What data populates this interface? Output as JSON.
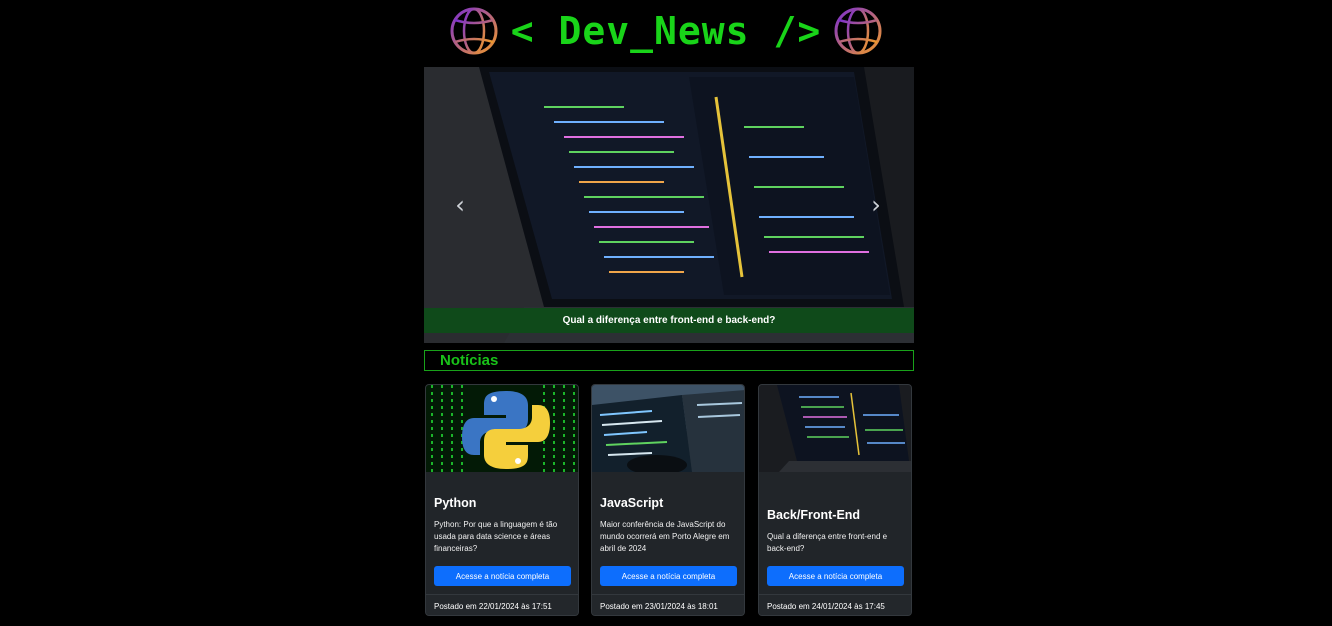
{
  "header": {
    "logo_text": "< Dev_News />",
    "left_icon": "globe-icon",
    "right_icon": "globe-icon",
    "brand_color": "#19d419"
  },
  "carousel": {
    "caption": "Qual a diferença entre front-end e back-end?",
    "prev_icon": "chevron-left-icon",
    "next_icon": "chevron-right-icon",
    "caption_bg": "#0f4a1a"
  },
  "section": {
    "title": "Notícias"
  },
  "cards": [
    {
      "title": "Python",
      "description": "Python: Por que a linguagem é tão usada para data science e áreas financeiras?",
      "button": "Acesse a notícia completa",
      "posted": "Postado em 22/01/2024 às 17:51",
      "image_icon": "python-logo-icon"
    },
    {
      "title": "JavaScript",
      "description": "Maior conferência de JavaScript do mundo ocorrerá em Porto Alegre em abril de 2024",
      "button": "Acesse a notícia completa",
      "posted": "Postado em 23/01/2024 às 18:01",
      "image_icon": "code-screens-image"
    },
    {
      "title": "Back/Front-End",
      "description": "Qual a diferença entre front-end e back-end?",
      "button": "Acesse a notícia completa",
      "posted": "Postado em 24/01/2024 às 17:45",
      "image_icon": "laptop-code-image"
    }
  ],
  "colors": {
    "button": "#0d6efd",
    "card_bg": "#212529",
    "accent_green": "#19c219"
  }
}
